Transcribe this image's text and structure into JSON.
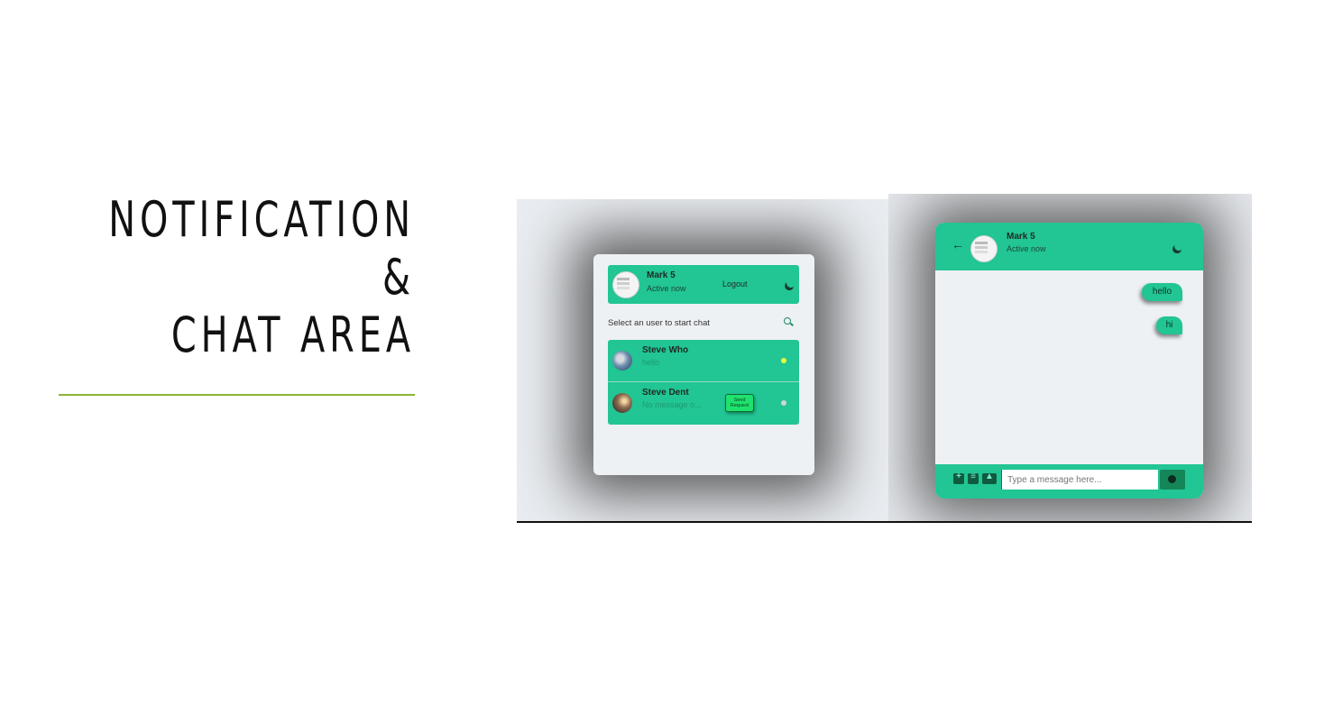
{
  "slide": {
    "title_line1": "NOTIFICATION &",
    "title_line2": "CHAT AREA"
  },
  "users_panel": {
    "header": {
      "name": "Mark 5",
      "status": "Active now",
      "logout_label": "Logout",
      "theme_icon": "moon-icon"
    },
    "prompt": "Select an user to start chat",
    "search_icon": "search-icon",
    "users": [
      {
        "name": "Steve Who",
        "message": "hello",
        "status_color": "#e6ff3a"
      },
      {
        "name": "Steve Dent",
        "message": "No message o...",
        "status_color": "#cfd6d2",
        "request_label": "Send Request"
      }
    ]
  },
  "chat_panel": {
    "header": {
      "name": "Mark 5",
      "status": "Active now",
      "back_icon": "arrow-left-icon",
      "theme_icon": "moon-icon"
    },
    "messages": [
      {
        "text": "hello",
        "side": "outgoing"
      },
      {
        "text": "hi",
        "side": "outgoing"
      }
    ],
    "footer": {
      "icons": [
        "add-file-icon",
        "document-icon",
        "image-icon"
      ],
      "placeholder": "Type a message here...",
      "send_icon": "send-icon"
    }
  },
  "colors": {
    "accent_green": "#22c594",
    "rule_green": "#8ab832",
    "request_button": "#1ee26d"
  }
}
